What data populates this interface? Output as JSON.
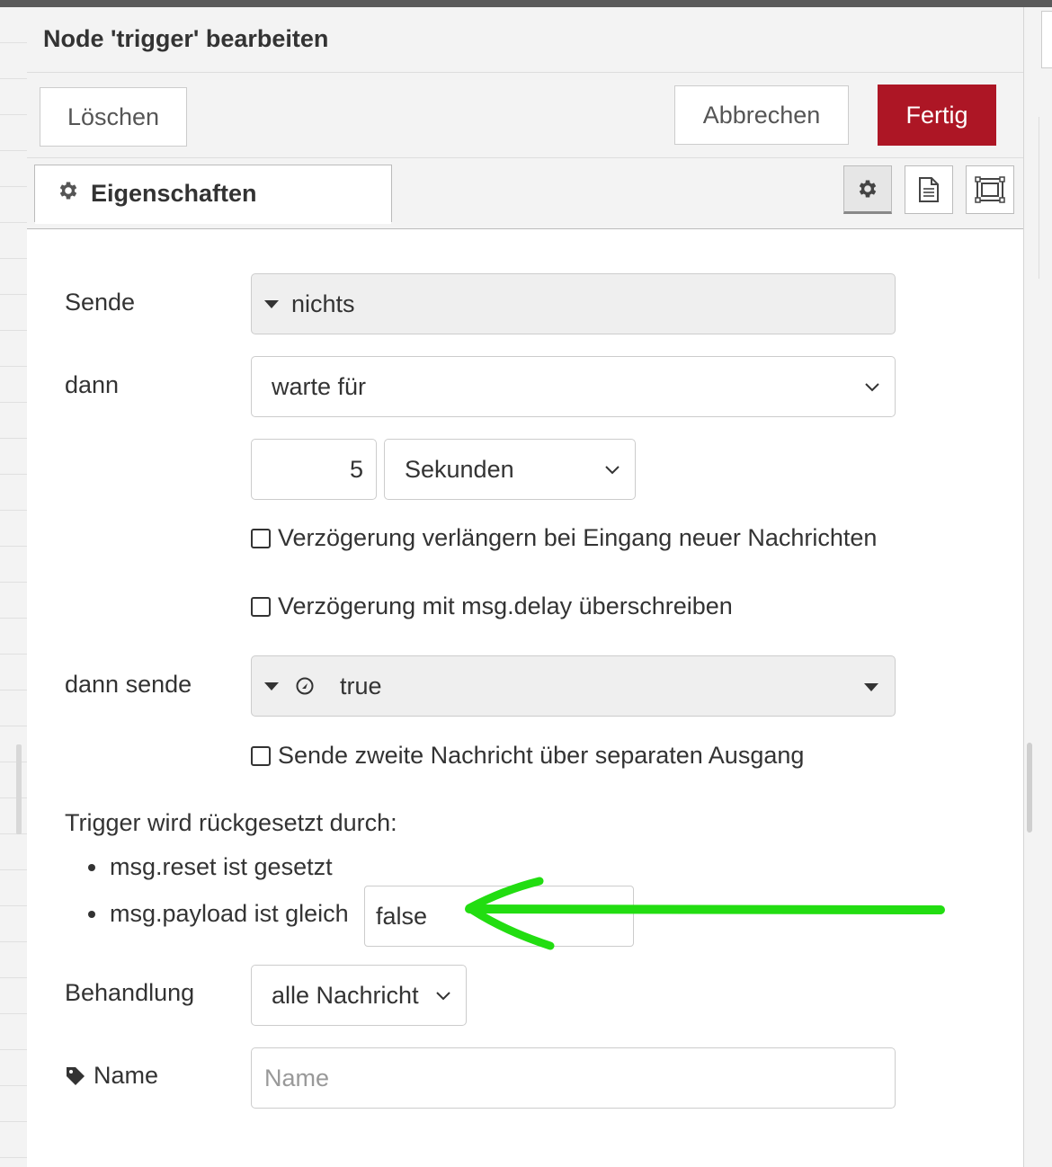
{
  "dialog": {
    "title": "Node 'trigger' bearbeiten",
    "buttons": {
      "delete": "Löschen",
      "cancel": "Abbrechen",
      "done": "Fertig"
    },
    "tab_label": "Eigenschaften",
    "tab_icons": [
      "gear-icon",
      "document-icon",
      "layout-icon"
    ]
  },
  "form": {
    "send": {
      "label": "Sende",
      "value": "nichts"
    },
    "then": {
      "label": "dann",
      "value": "warte für"
    },
    "duration": {
      "value": "5",
      "unit": "Sekunden"
    },
    "extend_checkbox": {
      "label": "Verzögerung verlängern bei Eingang neuer Nachrichten",
      "checked": false
    },
    "override_checkbox": {
      "label": "Verzögerung mit msg.delay überschreiben",
      "checked": false
    },
    "then_send": {
      "label": "dann sende",
      "value": "true",
      "type_icon": "boolean-icon"
    },
    "second_output_checkbox": {
      "label": "Sende zweite Nachricht über separaten Ausgang",
      "checked": false
    },
    "reset": {
      "heading": "Trigger wird rückgesetzt durch:",
      "items": [
        "msg.reset ist gesetzt",
        "msg.payload ist gleich"
      ],
      "payload_value": "false"
    },
    "handling": {
      "label": "Behandlung",
      "value": "alle Nachricht"
    },
    "name": {
      "label": "Name",
      "placeholder": "Name",
      "value": ""
    }
  },
  "annotation": {
    "color": "#22dd11",
    "shape": "arrow-pointing-left"
  },
  "colors": {
    "primary_button": "#ad1625"
  }
}
